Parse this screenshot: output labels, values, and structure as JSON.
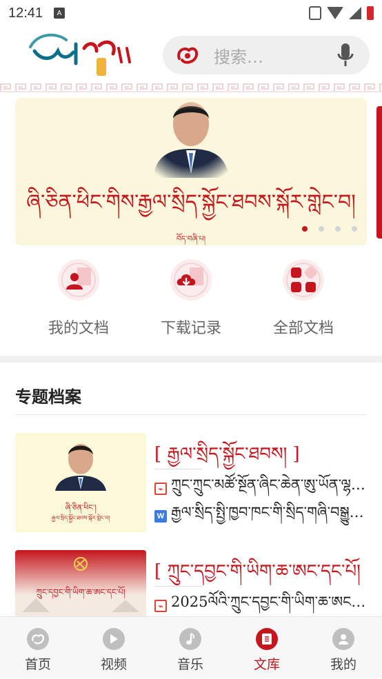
{
  "status_bar": {
    "time": "12:41",
    "notification_glyph": "A",
    "icons": [
      "vibrate-icon",
      "wifi-icon",
      "signal-icon",
      "battery-icon"
    ]
  },
  "header": {
    "logo_icon": "app-logo-icon",
    "search": {
      "placeholder": "搜索…",
      "left_icon": "app-mark-icon",
      "right_icon": "microphone-icon"
    }
  },
  "banner": {
    "title": "ཞི་ཅིན་ཕིང་གིས་རྒྱལ་སྲིད་སྐྱོང་ཐབས་སྐོར་གླེང་བ།",
    "subtitle": "བོད་བཞི་པ།",
    "slides_count": 4,
    "active_slide": 1
  },
  "quick_actions": [
    {
      "label": "我的文档",
      "icon": "person-document-icon"
    },
    {
      "label": "下载记录",
      "icon": "cloud-download-icon"
    },
    {
      "label": "全部文档",
      "icon": "grid-apps-icon"
    }
  ],
  "section": {
    "title": "专题档案"
  },
  "cards": [
    {
      "title": "[ རྒྱལ་སྲིད་སྐྱོང་ཐབས། ]",
      "thumb_caption_1": "ཞི་ཅིན་ཕིང་།",
      "thumb_caption_2": "རྒྱལ་སྲིད་སྐྱོང་ཐབས་སྐོར་གླེང་བ།",
      "docs": [
        {
          "type": "pdf",
          "name": "ཀྲུང་ཀྲུང་མཚོ་སྔོན་ཞིང་ཆེན་ཨུ་ཡོན་ལྷན་ཁང…"
        },
        {
          "type": "word",
          "name": "རྒྱལ་སྲིད་སྤྱི་ཁྱབ་ཁང་གི་སྲིད་གཞི་བསྒྱུར…"
        }
      ]
    },
    {
      "title": "[ ཀྲུང་དབྱང་གི་ཡིག་ཆ་ཨང་དང་པོ། ]",
      "thumb_caption_1": "ཀྲུང་དབྱང་གི་ཡིག་ཆ་ཨང་དང་པོ།",
      "docs": [
        {
          "type": "pdf",
          "name": "2025ལོའི་ཀྲུང་དབྱང་གི་ཡིག་ཆ་ཨང་དང…"
        }
      ]
    }
  ],
  "bottom_nav": {
    "active_index": 3,
    "items": [
      {
        "label": "首页",
        "icon": "home-mark-icon"
      },
      {
        "label": "视频",
        "icon": "play-icon"
      },
      {
        "label": "音乐",
        "icon": "music-note-icon"
      },
      {
        "label": "文库",
        "icon": "library-book-icon"
      },
      {
        "label": "我的",
        "icon": "profile-icon"
      }
    ]
  },
  "colors": {
    "accent": "#c4161c",
    "banner_bg": "#faf7dc",
    "text_muted": "#666666"
  }
}
